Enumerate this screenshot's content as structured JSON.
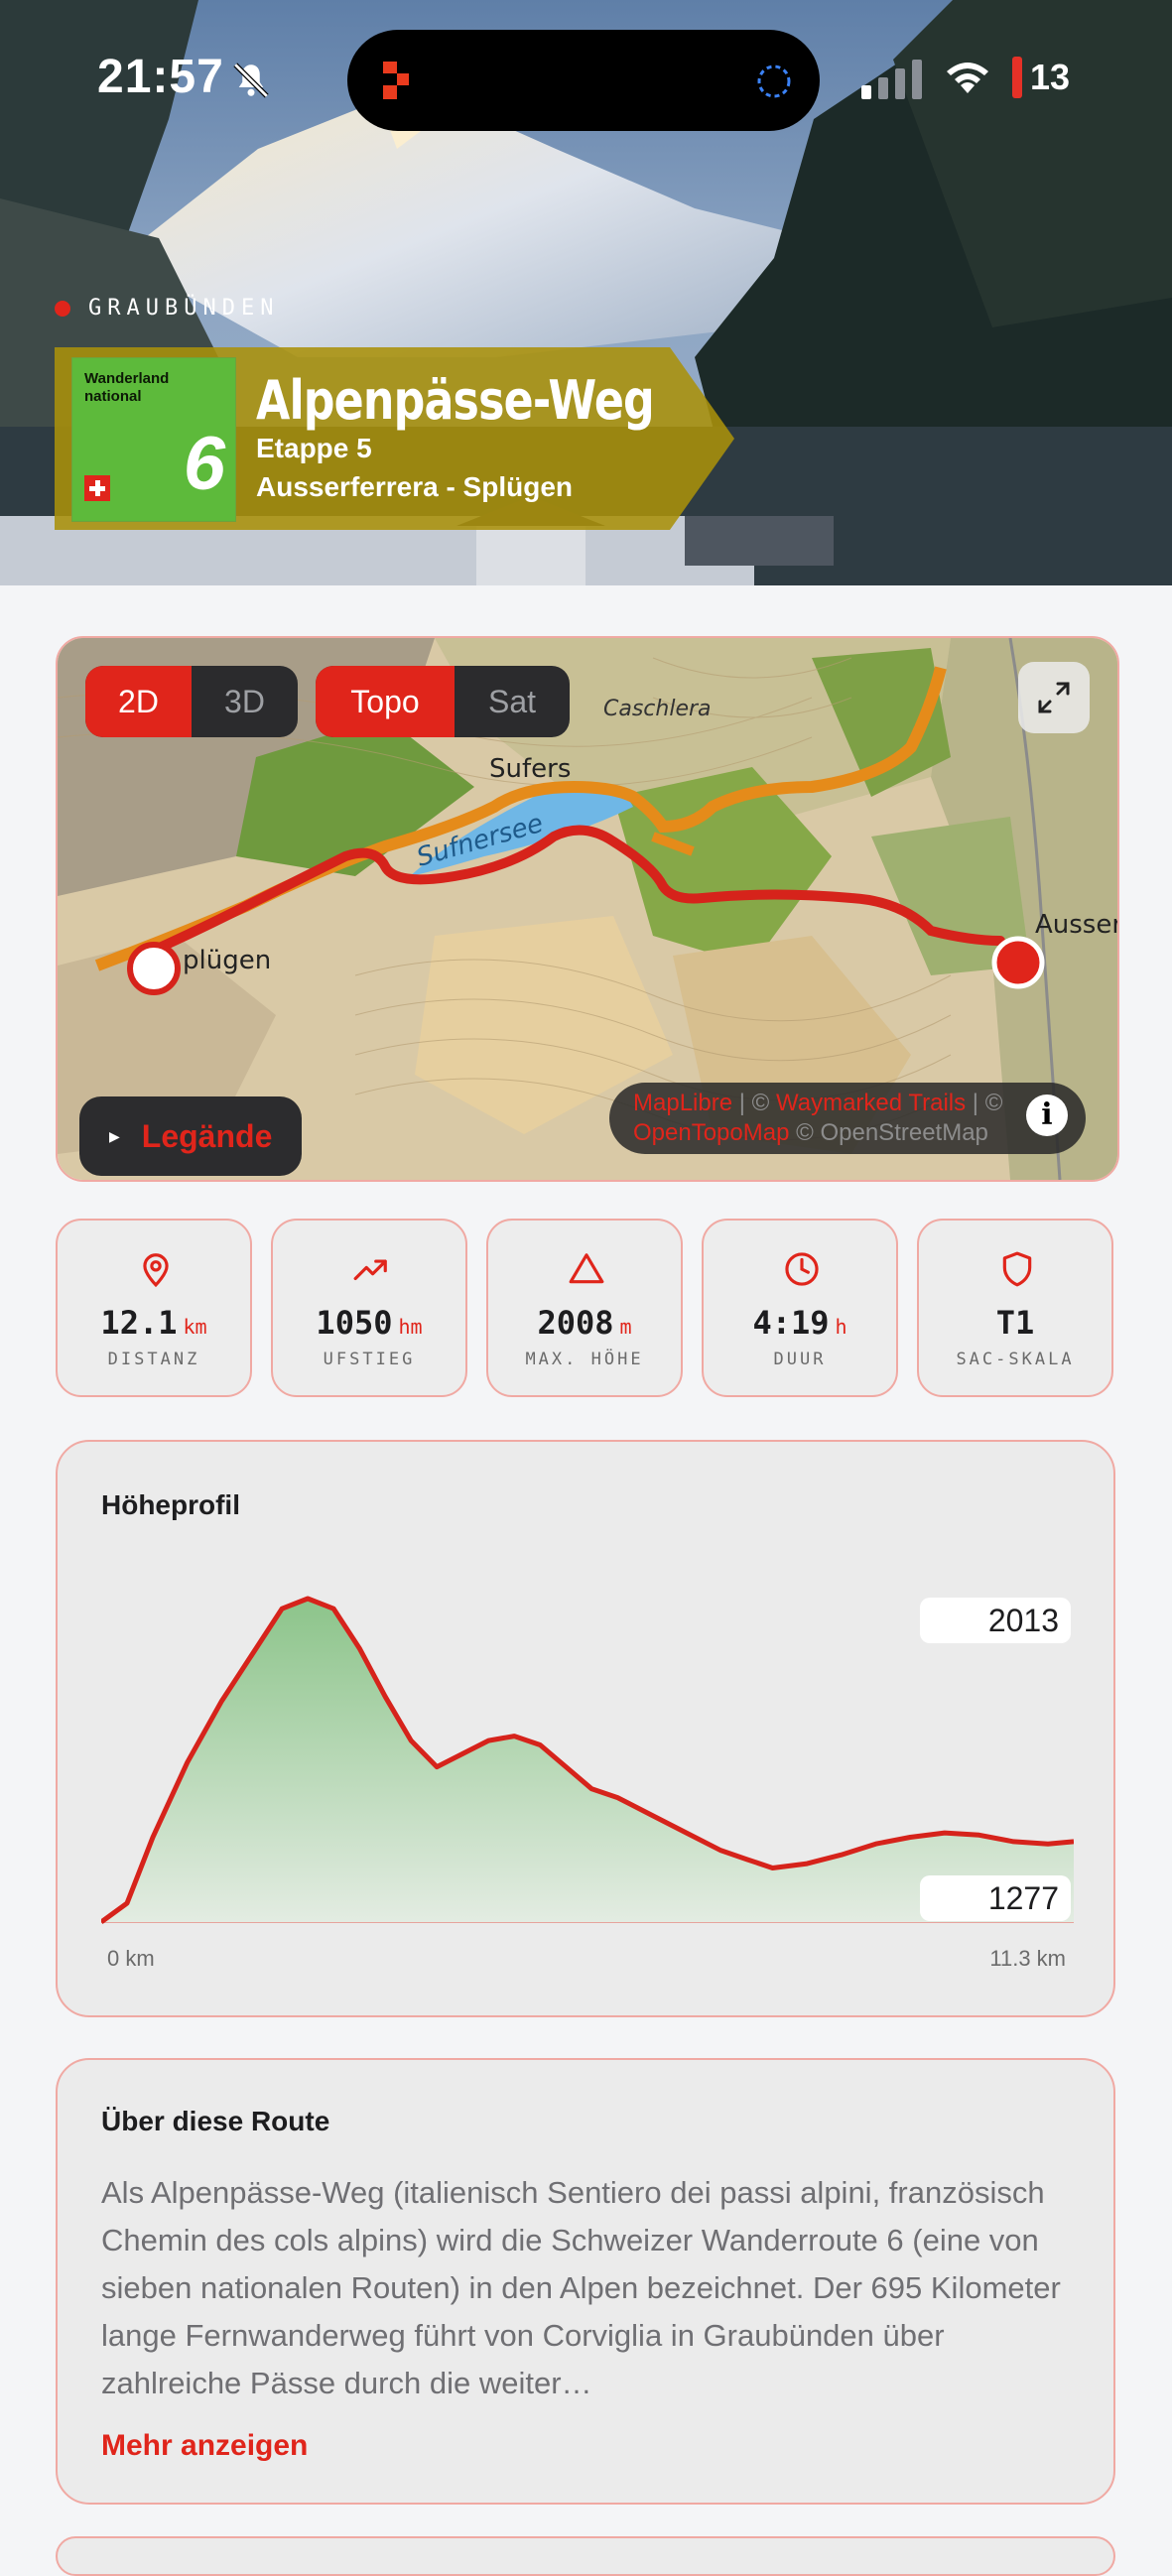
{
  "status_bar": {
    "time": "21:57",
    "battery": "13"
  },
  "hero": {
    "region": "GRAUBÜNDEN",
    "sign_title": "Wanderland national",
    "sign_number": "6",
    "title": "Alpenpässe-Weg",
    "stage": "Etappe 5",
    "route": "Ausserferrera - Splügen"
  },
  "map": {
    "view_2d": "2D",
    "view_3d": "3D",
    "style_topo": "Topo",
    "style_sat": "Sat",
    "legend_label": "Legände",
    "labels": {
      "caschlera": "Caschlera",
      "sufers": "Sufers",
      "sufnersee": "Sufnersee",
      "splugen": "plügen",
      "ausser": "Ausser"
    },
    "attribution": {
      "maplibre": "MapLibre",
      "sep1": " | © ",
      "waymarked": "Waymarked Trails",
      "sep2": " | ©",
      "opentopomap": "OpenTopoMap",
      "osm": " © OpenStreetMap"
    }
  },
  "stats": [
    {
      "icon": "location-pin-icon",
      "value": "12.1",
      "unit": "km",
      "label": "DISTANZ"
    },
    {
      "icon": "trending-up-icon",
      "value": "1050",
      "unit": "hm",
      "label": "UFSTIEG"
    },
    {
      "icon": "mountain-triangle-icon",
      "value": "2008",
      "unit": "m",
      "label": "MAX. HÖHE"
    },
    {
      "icon": "clock-icon",
      "value": "4:19",
      "unit": "h",
      "label": "DUUR"
    },
    {
      "icon": "shield-icon",
      "value": "T1",
      "unit": "",
      "label": "SAC-SKALA"
    }
  ],
  "profile": {
    "title": "Höheprofil",
    "max_label": "2013",
    "min_label": "1277",
    "x_start": "0 km",
    "x_end": "11.3 km"
  },
  "chart_data": {
    "type": "area",
    "title": "Höheprofil",
    "xlabel": "",
    "ylabel": "",
    "x_range": [
      0,
      11.3
    ],
    "y_range": [
      1277,
      2013
    ],
    "series": [
      {
        "x": [
          0,
          0.3,
          0.6,
          1.0,
          1.4,
          1.8,
          2.1,
          2.4,
          2.7,
          3.0,
          3.3,
          3.6,
          3.9,
          4.2,
          4.5,
          4.8,
          5.1,
          5.4,
          5.7,
          6.0,
          6.4,
          6.8,
          7.2,
          7.5,
          7.8,
          8.2,
          8.6,
          9.0,
          9.4,
          9.8,
          10.2,
          10.6,
          11.0,
          11.3
        ],
        "values": [
          1277,
          1320,
          1470,
          1640,
          1780,
          1900,
          1990,
          2013,
          1990,
          1900,
          1790,
          1690,
          1630,
          1660,
          1690,
          1700,
          1680,
          1630,
          1580,
          1560,
          1520,
          1480,
          1440,
          1420,
          1400,
          1410,
          1430,
          1455,
          1470,
          1480,
          1475,
          1460,
          1455,
          1460
        ]
      }
    ]
  },
  "about": {
    "title": "Über diese Route",
    "text": "Als Alpenpässe-Weg (italienisch Sentiero dei passi alpini, französisch Chemin des cols alpins) wird die Schweizer Wanderroute 6 (eine von sieben nationalen Routen) in den Alpen bezeichnet. Der 695 Kilometer lange Fernwanderweg führt von Corviglia in Graubünden über zahlreiche Pässe durch die weiter…",
    "more": "Mehr anzeigen"
  },
  "colors": {
    "accent": "#e0251b",
    "banner": "#a08a16",
    "sign_green": "#5dba3b"
  }
}
